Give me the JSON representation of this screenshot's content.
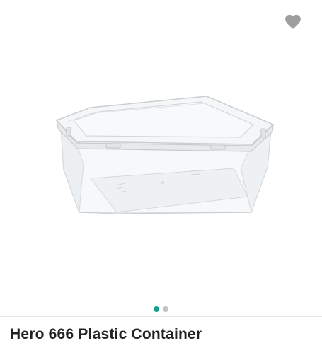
{
  "product": {
    "title": "Hero 666 Plastic Container",
    "image_alt": "Transparent rectangular plastic container with lid"
  },
  "wishlist": {
    "icon": "heart-icon",
    "color": "#9e9e9e"
  },
  "carousel": {
    "dot_count": 2,
    "active_index": 0,
    "active_color": "#1a9c8f",
    "inactive_color": "#c4c4c4"
  }
}
